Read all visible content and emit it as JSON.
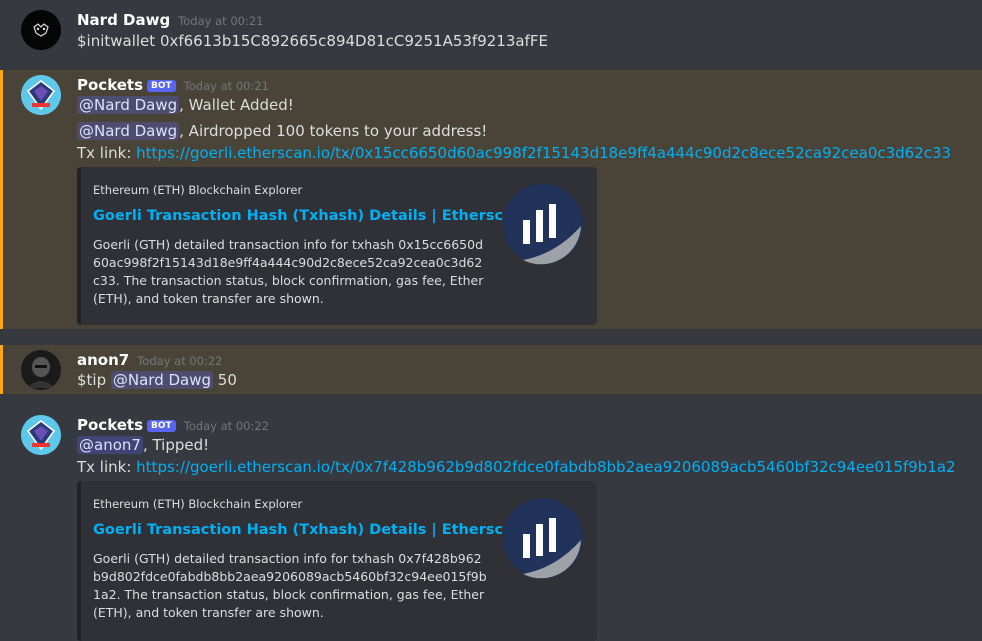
{
  "messages": [
    {
      "author": "Nard Dawg",
      "timestamp": "Today at 00:21",
      "avatar_icon": "mask-icon",
      "content": "$initwallet 0xf6613b15C892665c894D81cC9251A53f9213afFE"
    },
    {
      "author": "Pockets",
      "bot_tag": "BOT",
      "timestamp": "Today at 00:21",
      "avatar_icon": "pockets-bot-icon",
      "line1": {
        "mention": "@Nard Dawg",
        "text": ", Wallet Added!"
      },
      "line2": {
        "mention": "@Nard Dawg",
        "text": ", Airdropped 100 tokens to your address!"
      },
      "line3": {
        "prefix": "Tx link: ",
        "url": "https://goerli.etherscan.io/tx/0x15cc6650d60ac998f2f15143d18e9ff4a444c90d2c8ece52ca92cea0c3d62c33"
      },
      "embed": {
        "provider": "Ethereum (ETH) Blockchain Explorer",
        "title": "Goerli Transaction Hash (Txhash) Details | Etherscan",
        "description": "Goerli (GTH) detailed transaction info for txhash 0x15cc6650d60ac998f2f15143d18e9ff4a444c90d2c8ece52ca92cea0c3d62c33. The transaction status, block confirmation, gas fee, Ether (ETH), and token transfer are shown.",
        "thumb_icon": "etherscan-logo-icon"
      }
    },
    {
      "author": "anon7",
      "timestamp": "Today at 00:22",
      "avatar_icon": "user-photo-icon",
      "prefix": "$tip ",
      "mention": "@Nard Dawg",
      "suffix": " 50"
    },
    {
      "author": "Pockets",
      "bot_tag": "BOT",
      "timestamp": "Today at 00:22",
      "avatar_icon": "pockets-bot-icon",
      "line1": {
        "mention": "@anon7",
        "text": ", Tipped!"
      },
      "line2": {
        "prefix": "Tx link: ",
        "url": "https://goerli.etherscan.io/tx/0x7f428b962b9d802fdce0fabdb8bb2aea9206089acb5460bf32c94ee015f9b1a2"
      },
      "embed": {
        "provider": "Ethereum (ETH) Blockchain Explorer",
        "title": "Goerli Transaction Hash (Txhash) Details | Etherscan",
        "description": "Goerli (GTH) detailed transaction info for txhash 0x7f428b962b9d802fdce0fabdb8bb2aea9206089acb5460bf32c94ee015f9b1a2. The transaction status, block confirmation, gas fee, Ether (ETH), and token transfer are shown.",
        "thumb_icon": "etherscan-logo-icon"
      }
    }
  ],
  "colors": {
    "background": "#36393f",
    "highlight": "#4a4438",
    "highlight_bar": "#faa81a",
    "link": "#00b0f4",
    "embed_bg": "#2f3136",
    "bot_tag": "#5865f2"
  }
}
